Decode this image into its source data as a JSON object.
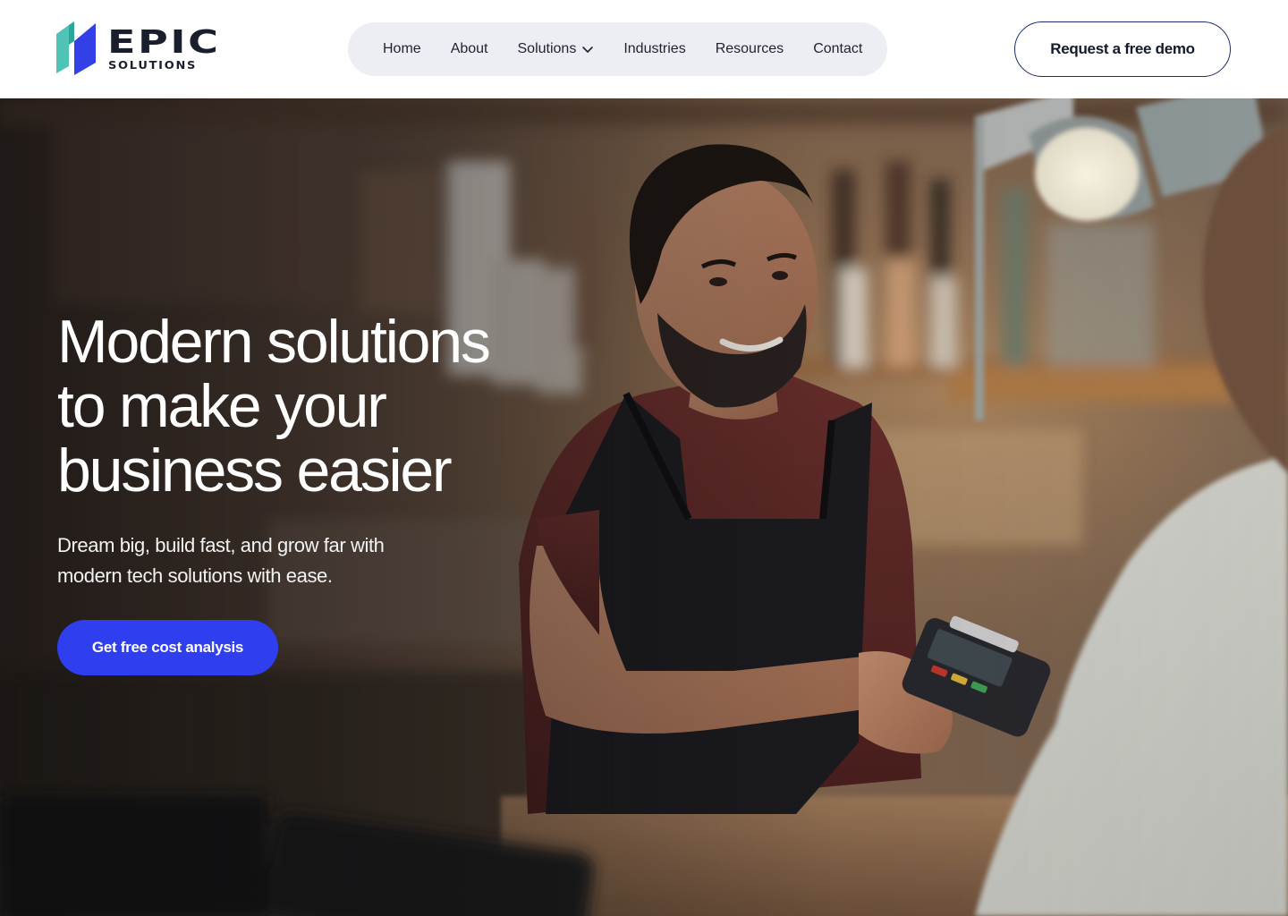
{
  "brand": {
    "name": "EPIC",
    "tagline": "SOLUTIONS",
    "colors": {
      "mark_teal": "#4fc3b5",
      "mark_blue": "#3340e8",
      "text_dark": "#1a1f2e"
    }
  },
  "nav": {
    "items": [
      {
        "label": "Home"
      },
      {
        "label": "About"
      },
      {
        "label": "Solutions",
        "icon": "chevron-down-icon"
      },
      {
        "label": "Industries"
      },
      {
        "label": "Resources"
      },
      {
        "label": "Contact"
      }
    ]
  },
  "header": {
    "demo_button_label": "Request a free demo"
  },
  "hero": {
    "title_lines": [
      "Modern solutions",
      "to make your",
      "business easier"
    ],
    "subtitle": "Dream big, build fast, and grow far with modern tech solutions with ease.",
    "cta_label": "Get free cost analysis",
    "cta_color": "#2f3ff0",
    "image_description_icon": "barista-payment-photo"
  }
}
